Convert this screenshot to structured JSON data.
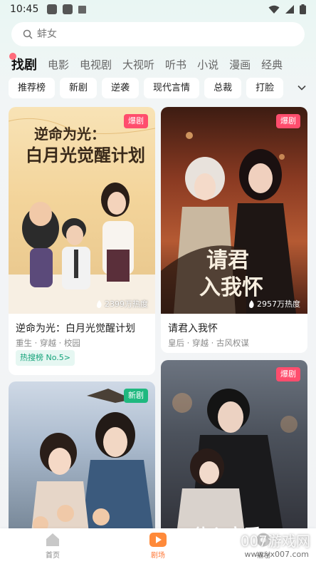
{
  "status_bar": {
    "time": "10:45"
  },
  "search": {
    "placeholder": "蚌女"
  },
  "tabs": [
    {
      "label": "找剧",
      "active": true
    },
    {
      "label": "电影"
    },
    {
      "label": "电视剧"
    },
    {
      "label": "大视听"
    },
    {
      "label": "听书"
    },
    {
      "label": "小说"
    },
    {
      "label": "漫画"
    },
    {
      "label": "经典"
    }
  ],
  "chips": [
    "推荐榜",
    "新剧",
    "逆袭",
    "现代言情",
    "总裁",
    "打脸"
  ],
  "cards": [
    {
      "badge": "爆剧",
      "poster_title": "逆命为光：",
      "poster_title2": "白月光觉醒计划",
      "heat": "2399万热度",
      "title": "逆命为光：白月光觉醒计划",
      "tags": "重生 · 穿越 · 校园",
      "rank": "热搜榜 No.5",
      "rank_arrow": ">"
    },
    {
      "badge": "爆剧",
      "poster_title": "请君",
      "poster_title2": "入我怀",
      "heat": "2957万热度",
      "title": "请君入我怀",
      "tags": "皇后 · 穿越 · 古风权谋"
    },
    {
      "badge": "新剧"
    },
    {
      "badge": "爆剧",
      "poster_title": "偏心恋爱"
    }
  ],
  "nav": [
    {
      "label": "首页"
    },
    {
      "label": "剧场",
      "active": true
    },
    {
      "label": "福利"
    }
  ],
  "watermark": {
    "text": "007游戏网",
    "url": "www.yx007.com"
  },
  "colors": {
    "accent": "#ff7a3a",
    "hot_badge": "#ff4d6d",
    "new_badge": "#1fb87f",
    "rank_green": "#15a37a"
  }
}
